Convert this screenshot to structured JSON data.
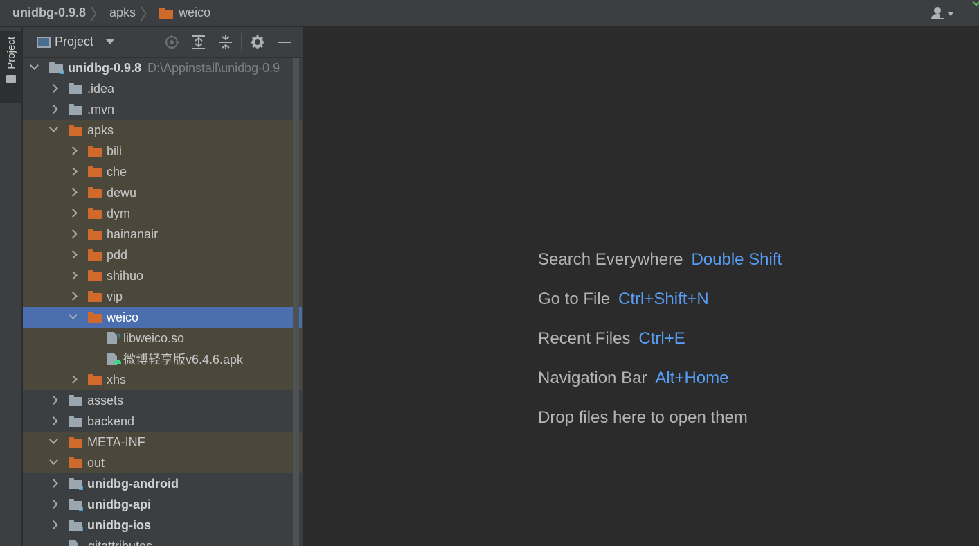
{
  "navbar": {
    "crumbs": [
      "unidbg-0.9.8",
      "apks",
      "weico"
    ]
  },
  "tool_stripe": {
    "project_tab": "Project"
  },
  "panel": {
    "title": "Project",
    "tools": [
      "locate-icon",
      "expand-all-icon",
      "collapse-all-icon",
      "gear-icon",
      "minimize-icon"
    ]
  },
  "tree": {
    "root": {
      "label": "unidbg-0.9.8",
      "path": "D:\\Appinstall\\unidbg-0.9"
    },
    "items": [
      {
        "label": ".idea"
      },
      {
        "label": ".mvn"
      },
      {
        "label": "apks"
      },
      {
        "label": "bili"
      },
      {
        "label": "che"
      },
      {
        "label": "dewu"
      },
      {
        "label": "dym"
      },
      {
        "label": "hainanair"
      },
      {
        "label": "pdd"
      },
      {
        "label": "shihuo"
      },
      {
        "label": "vip"
      },
      {
        "label": "weico"
      },
      {
        "label": "libweico.so"
      },
      {
        "label": "微博轻享版v6.4.6.apk"
      },
      {
        "label": "xhs"
      },
      {
        "label": "assets"
      },
      {
        "label": "backend"
      },
      {
        "label": "META-INF"
      },
      {
        "label": "out"
      },
      {
        "label": "unidbg-android"
      },
      {
        "label": "unidbg-api"
      },
      {
        "label": "unidbg-ios"
      },
      {
        "label": ".gitattributes"
      }
    ]
  },
  "editor": {
    "hints": [
      {
        "label": "Search Everywhere",
        "key": "Double Shift"
      },
      {
        "label": "Go to File",
        "key": "Ctrl+Shift+N"
      },
      {
        "label": "Recent Files",
        "key": "Ctrl+E"
      },
      {
        "label": "Navigation Bar",
        "key": "Alt+Home"
      },
      {
        "label": "Drop files here to open them",
        "key": ""
      }
    ]
  },
  "colors": {
    "accent": "#589df6",
    "selection": "#4b6eaf",
    "excluded_tint": "#4c473b",
    "folder_orange": "#d06a2c",
    "folder_gray": "#9aa7b0"
  }
}
